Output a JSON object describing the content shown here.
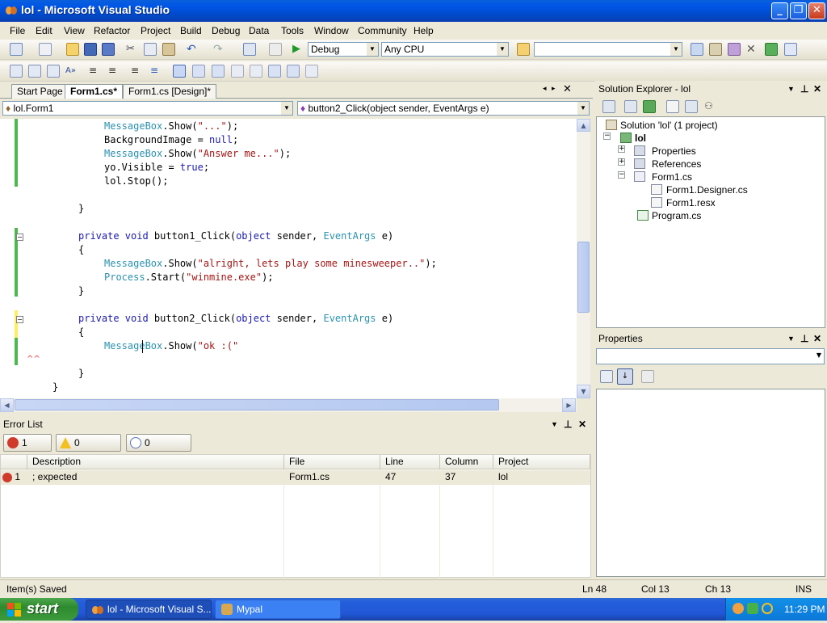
{
  "window": {
    "title": "lol - Microsoft Visual Studio"
  },
  "menu": [
    "File",
    "Edit",
    "View",
    "Refactor",
    "Project",
    "Build",
    "Debug",
    "Data",
    "Tools",
    "Window",
    "Community",
    "Help"
  ],
  "toolbar": {
    "config": "Debug",
    "platform": "Any CPU",
    "find": ""
  },
  "tabs": [
    {
      "label": "Start Page",
      "active": false
    },
    {
      "label": "Form1.cs*",
      "active": true
    },
    {
      "label": "Form1.cs [Design]*",
      "active": false
    }
  ],
  "nav": {
    "class": "lol.Form1",
    "member": "button2_Click(object sender, EventArgs e)"
  },
  "code": {
    "l1": {
      "a": "MessageBox",
      "b": ".Show(",
      "c": "\"...\"",
      "d": ");"
    },
    "l2": {
      "a": "BackgroundImage = ",
      "b": "null",
      "c": ";"
    },
    "l3": {
      "a": "MessageBox",
      "b": ".Show(",
      "c": "\"Answer me...\"",
      "d": ");"
    },
    "l4": {
      "a": "yo.Visible = ",
      "b": "true",
      "c": ";"
    },
    "l5": "lol.Stop();",
    "l6": "}",
    "l7": {
      "a": "private void",
      "b": " button1_Click(",
      "c": "object",
      "d": " sender, ",
      "e": "EventArgs",
      "f": " e)"
    },
    "l8": "{",
    "l9": {
      "a": "MessageBox",
      "b": ".Show(",
      "c": "\"alright, lets play some minesweeper..\"",
      "d": ");"
    },
    "l10": {
      "a": "Process",
      "b": ".Start(",
      "c": "\"winmine.exe\"",
      "d": ");"
    },
    "l11": "}",
    "l12": {
      "a": "private void",
      "b": " button2_Click(",
      "c": "object",
      "d": " sender, ",
      "e": "EventArgs",
      "f": " e)"
    },
    "l13": "{",
    "l14": {
      "a": "MessageBox",
      "b": ".Show(",
      "c": "\"ok :(\""
    },
    "l15": "}",
    "l16": "}"
  },
  "errorlist": {
    "title": "Error List",
    "errors_btn": "1 Error",
    "warnings_btn": "0 Warnings",
    "messages_btn": "0 Messages",
    "columns": [
      "Description",
      "File",
      "Line",
      "Column",
      "Project"
    ],
    "rows": [
      {
        "num": "1",
        "description": "; expected",
        "file": "Form1.cs",
        "line": "47",
        "column": "37",
        "project": "lol"
      }
    ]
  },
  "solution": {
    "title": "Solution Explorer - lol",
    "root": "Solution 'lol' (1 project)",
    "project": "lol",
    "items": [
      "Properties",
      "References",
      "Form1.cs",
      "Form1.Designer.cs",
      "Form1.resx",
      "Program.cs"
    ]
  },
  "properties": {
    "title": "Properties"
  },
  "status": {
    "message": "Item(s) Saved",
    "ln": "Ln 48",
    "col": "Col 13",
    "ch": "Ch 13",
    "mode": "INS"
  },
  "taskbar": {
    "start": "start",
    "tasks": [
      "lol - Microsoft Visual S...",
      "Mypal"
    ],
    "clock": "11:29 PM"
  }
}
